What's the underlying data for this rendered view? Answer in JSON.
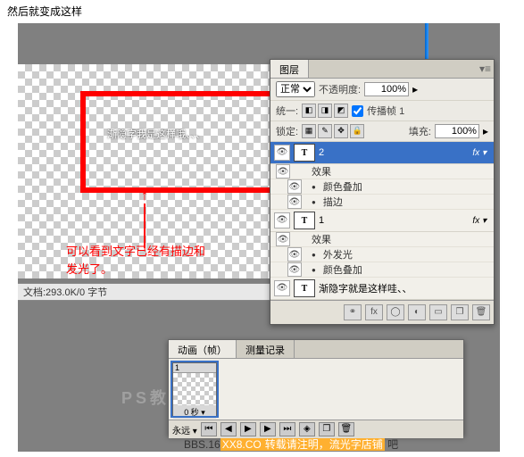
{
  "caption": "然后就变成这样",
  "canvas_text": "渐隐字我是这样哦、、、",
  "note_line1": "可以看到文字已经有描边和",
  "note_line2": "发光了。",
  "doc_status": "文档:293.0K/0 字节",
  "layers_panel": {
    "tab": "图层",
    "blend_mode": "正常",
    "opacity_label": "不透明度:",
    "opacity_value": "100%",
    "unify_label": "统一:",
    "propagate_label": "传播帧 1",
    "lock_label": "锁定:",
    "fill_label": "填充:",
    "fill_value": "100%",
    "layers": [
      {
        "name": "2",
        "type": "T",
        "selected": true,
        "fx": true,
        "effects": [
          "效果",
          "颜色叠加",
          "描边"
        ]
      },
      {
        "name": "1",
        "type": "T",
        "selected": false,
        "fx": true,
        "effects": [
          "效果",
          "外发光",
          "颜色叠加"
        ]
      },
      {
        "name": "渐隐字就是这样哇、、",
        "type": "T",
        "selected": false,
        "fx": false
      }
    ]
  },
  "anim_panel": {
    "tab1": "动画（帧）",
    "tab2": "测量记录",
    "frame_num": "1",
    "frame_dur": "0 秒",
    "loop": "永远"
  },
  "watermark": {
    "prefix": "BBS.16",
    "hl1": "XX8.CO",
    "mid": "转载请注明，流光字店铺",
    "suf": "吧"
  },
  "ghost": "PS教程论坛"
}
